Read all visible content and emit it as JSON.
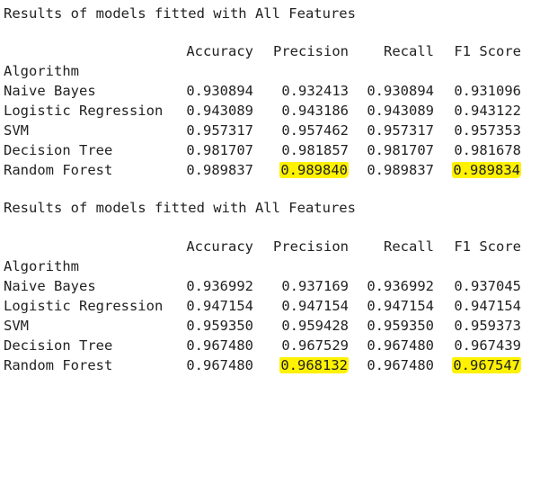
{
  "tables": [
    {
      "title": "Results of models fitted with All Features",
      "columns": [
        "Accuracy",
        "Precision",
        "Recall",
        "F1 Score"
      ],
      "index_name": "Algorithm",
      "rows": [
        {
          "name": "Naive Bayes",
          "values": [
            "0.930894",
            "0.932413",
            "0.930894",
            "0.931096"
          ]
        },
        {
          "name": "Logistic Regression",
          "values": [
            "0.943089",
            "0.943186",
            "0.943089",
            "0.943122"
          ]
        },
        {
          "name": "SVM",
          "values": [
            "0.957317",
            "0.957462",
            "0.957317",
            "0.957353"
          ]
        },
        {
          "name": "Decision Tree",
          "values": [
            "0.981707",
            "0.981857",
            "0.981707",
            "0.981678"
          ]
        },
        {
          "name": "Random Forest",
          "values": [
            "0.989837",
            "0.989840",
            "0.989837",
            "0.989834"
          ]
        }
      ],
      "highlighted": [
        {
          "row": 4,
          "col": 1
        },
        {
          "row": 4,
          "col": 3
        }
      ]
    },
    {
      "title": "Results of models fitted with All Features",
      "columns": [
        "Accuracy",
        "Precision",
        "Recall",
        "F1 Score"
      ],
      "index_name": "Algorithm",
      "rows": [
        {
          "name": "Naive Bayes",
          "values": [
            "0.936992",
            "0.937169",
            "0.936992",
            "0.937045"
          ]
        },
        {
          "name": "Logistic Regression",
          "values": [
            "0.947154",
            "0.947154",
            "0.947154",
            "0.947154"
          ]
        },
        {
          "name": "SVM",
          "values": [
            "0.959350",
            "0.959428",
            "0.959350",
            "0.959373"
          ]
        },
        {
          "name": "Decision Tree",
          "values": [
            "0.967480",
            "0.967529",
            "0.967480",
            "0.967439"
          ]
        },
        {
          "name": "Random Forest",
          "values": [
            "0.967480",
            "0.968132",
            "0.967480",
            "0.967547"
          ]
        }
      ],
      "highlighted": [
        {
          "row": 4,
          "col": 1
        },
        {
          "row": 4,
          "col": 3
        }
      ]
    }
  ],
  "colors": {
    "text": "#222222",
    "highlight": "#fff200",
    "background": "#ffffff"
  }
}
